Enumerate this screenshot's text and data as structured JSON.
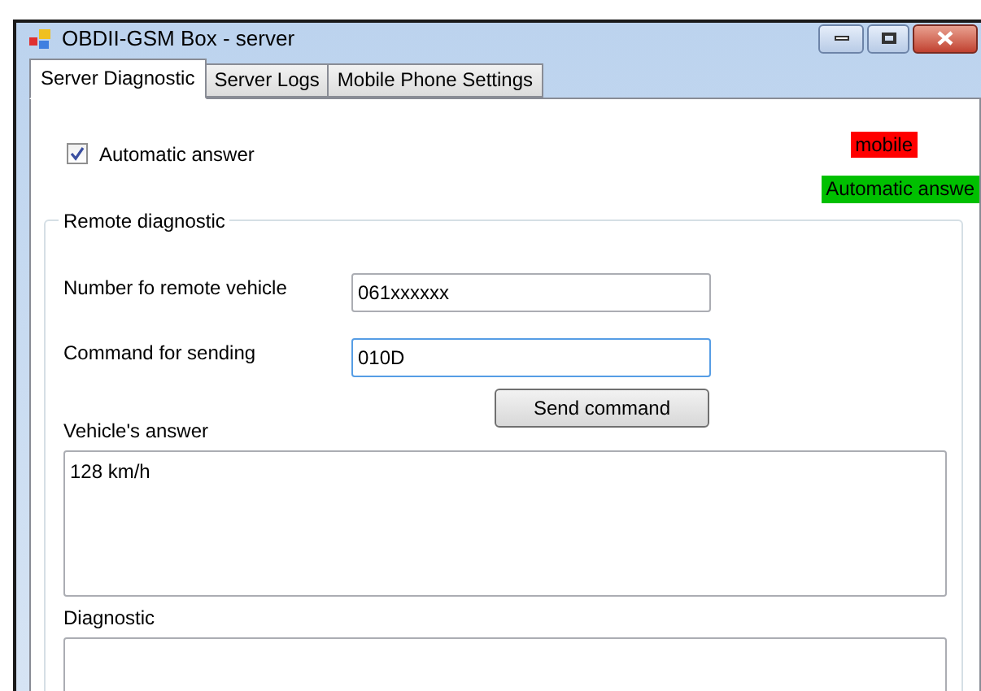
{
  "window": {
    "title": "OBDII-GSM Box - server"
  },
  "tabs": [
    {
      "label": "Server Diagnostic",
      "selected": true
    },
    {
      "label": "Server Logs",
      "selected": false
    },
    {
      "label": "Mobile Phone Settings",
      "selected": false
    }
  ],
  "automatic_answer": {
    "label": "Automatic answer",
    "checked": true
  },
  "indicators": [
    {
      "text": "mobile",
      "color": "#ff0000"
    },
    {
      "text": "Automatic answe",
      "color": "#00c000"
    }
  ],
  "remote_diagnostic": {
    "title": "Remote diagnostic",
    "fields": [
      {
        "label": "Number fo remote vehicle",
        "value": "061xxxxxx",
        "focused": false
      },
      {
        "label": "Command for sending",
        "value": "010D",
        "focused": true
      }
    ],
    "send_button": "Send command",
    "answer": {
      "label": "Vehicle's answer",
      "value": "128 km/h"
    },
    "diagnostic": {
      "label": "Diagnostic"
    }
  }
}
